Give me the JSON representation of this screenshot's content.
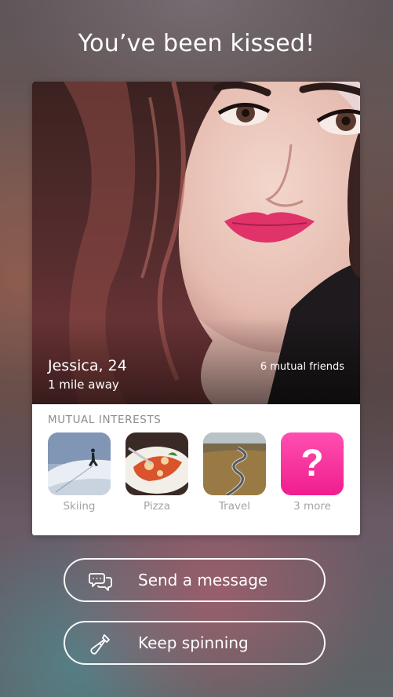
{
  "header": {
    "title": "You’ve been kissed!"
  },
  "profile": {
    "name_age": "Jessica, 24",
    "distance": "1 mile away",
    "mutual_friends": "6 mutual friends"
  },
  "interests": {
    "label": "MUTUAL INTERESTS",
    "items": [
      {
        "label": "Skiing",
        "icon": "skiing-photo"
      },
      {
        "label": "Pizza",
        "icon": "pizza-photo"
      },
      {
        "label": "Travel",
        "icon": "road-photo"
      },
      {
        "label": "3 more",
        "icon": "question-mark-icon",
        "glyph": "?"
      }
    ]
  },
  "actions": {
    "message_label": "Send a message",
    "spin_label": "Keep spinning"
  },
  "colors": {
    "accent_pink": "#f01d8e",
    "lip_pink": "#e0336a"
  }
}
